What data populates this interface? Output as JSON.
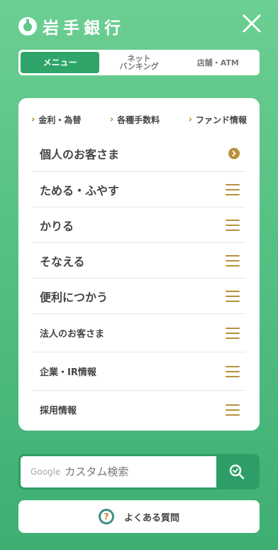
{
  "header": {
    "logo_text": "岩手銀行",
    "logo_icon": "bank-logo-icon",
    "close_icon": "close-icon"
  },
  "tabs": [
    {
      "label": "メニュー",
      "active": true
    },
    {
      "label": "ネット\nバンキング",
      "active": false
    },
    {
      "label": "店舗・ATM",
      "active": false
    }
  ],
  "quick_links": [
    {
      "label": "金利・為替"
    },
    {
      "label": "各種手数料"
    },
    {
      "label": "ファンド情報"
    }
  ],
  "menu": {
    "items": [
      {
        "label": "個人のお客さま",
        "icon": "chevron-circle-icon"
      },
      {
        "label": "ためる・ふやす",
        "icon": "hamburger-icon"
      },
      {
        "label": "かりる",
        "icon": "hamburger-icon"
      },
      {
        "label": "そなえる",
        "icon": "hamburger-icon"
      },
      {
        "label": "便利につかう",
        "icon": "hamburger-icon"
      },
      {
        "label": "法人のお客さま",
        "icon": "hamburger-icon"
      },
      {
        "label": "企業・IR情報",
        "icon": "hamburger-icon"
      },
      {
        "label": "採用情報",
        "icon": "hamburger-icon"
      }
    ]
  },
  "search": {
    "google_label": "Google",
    "placeholder": "カスタム検索",
    "icon": "search-icon"
  },
  "faq": {
    "label": "よくある質問",
    "icon": "question-icon"
  },
  "colors": {
    "accent_green": "#2fa56a",
    "gold": "#b8903c",
    "background_green": "#55c083"
  }
}
